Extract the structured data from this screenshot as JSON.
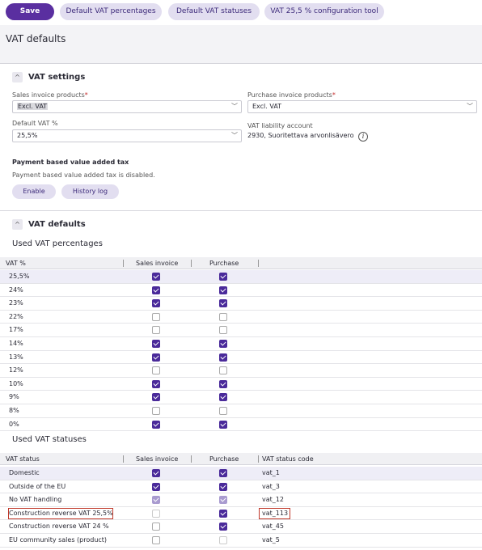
{
  "toolbar": {
    "save": "Save",
    "default_vat_percentages": "Default VAT percentages",
    "default_vat_statuses": "Default VAT statuses",
    "config_tool": "VAT 25,5 % configuration tool"
  },
  "page_title": "VAT defaults",
  "vat_settings": {
    "title": "VAT settings",
    "sales_label": "Sales invoice products",
    "sales_value": "Excl. VAT",
    "purchase_label": "Purchase invoice products",
    "purchase_value": "Excl. VAT",
    "default_vat_label": "Default VAT %",
    "default_vat_value": "25,5%",
    "liability_label": "VAT liability account",
    "liability_value": "2930, Suoritettava arvonlisävero",
    "required_mark": "*",
    "payment_title": "Payment based value added tax",
    "payment_text": "Payment based value added tax is disabled.",
    "enable": "Enable",
    "history_log": "History log"
  },
  "vat_defaults": {
    "title": "VAT defaults",
    "percentages_title": "Used VAT percentages",
    "pct_headers": {
      "vat": "VAT %",
      "sales": "Sales invoice",
      "purchase": "Purchase"
    },
    "percentages": [
      {
        "label": "25,5%",
        "sales": true,
        "purchase": true
      },
      {
        "label": "24%",
        "sales": true,
        "purchase": true
      },
      {
        "label": "23%",
        "sales": true,
        "purchase": true
      },
      {
        "label": "22%",
        "sales": false,
        "purchase": false
      },
      {
        "label": "17%",
        "sales": false,
        "purchase": false
      },
      {
        "label": "14%",
        "sales": true,
        "purchase": true
      },
      {
        "label": "13%",
        "sales": true,
        "purchase": true
      },
      {
        "label": "12%",
        "sales": false,
        "purchase": false
      },
      {
        "label": "10%",
        "sales": true,
        "purchase": true
      },
      {
        "label": "9%",
        "sales": true,
        "purchase": true
      },
      {
        "label": "8%",
        "sales": false,
        "purchase": false
      },
      {
        "label": "0%",
        "sales": true,
        "purchase": true
      }
    ],
    "statuses_title": "Used VAT statuses",
    "status_headers": {
      "status": "VAT status",
      "sales": "Sales invoice",
      "purchase": "Purchase",
      "code": "VAT status code"
    },
    "statuses": [
      {
        "label": "Domestic",
        "sales": "on",
        "purchase": "on",
        "code": "vat_1"
      },
      {
        "label": "Outside of the EU",
        "sales": "on",
        "purchase": "on",
        "code": "vat_3"
      },
      {
        "label": "No VAT handling",
        "sales": "dim-on",
        "purchase": "dim-on",
        "code": "vat_12"
      },
      {
        "label": "Construction reverse VAT 25,5%",
        "sales": "dim-off",
        "purchase": "on",
        "code": "vat_113"
      },
      {
        "label": "Construction reverse VAT 24 %",
        "sales": "off",
        "purchase": "on",
        "code": "vat_45"
      },
      {
        "label": "EU community sales (product)",
        "sales": "off",
        "purchase": "dim-off",
        "code": "vat_5"
      }
    ]
  },
  "colors": {
    "accent": "#5a2fa0",
    "checkbox_on": "#4a2a9a",
    "highlight_border": "#c0392b"
  }
}
